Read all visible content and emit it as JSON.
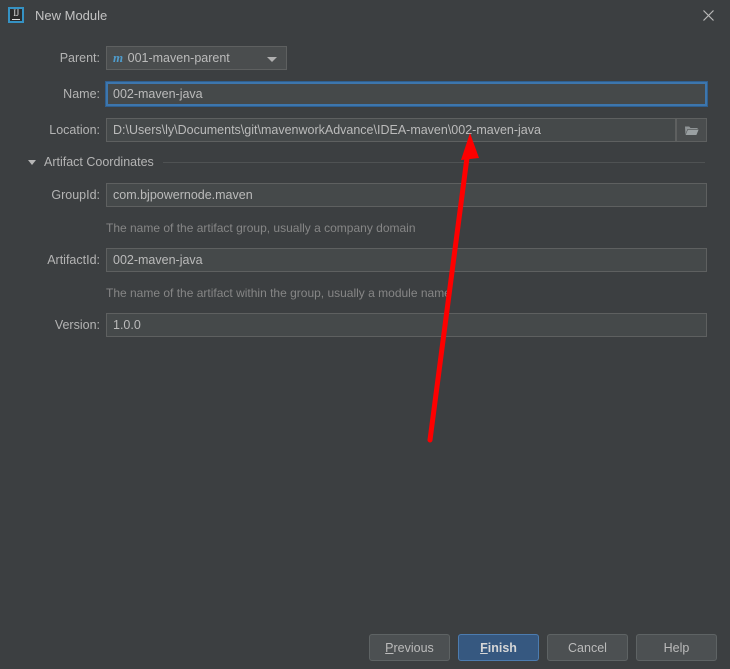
{
  "window": {
    "title": "New Module",
    "app_icon": "intellij-idea-icon",
    "close_label": "✕"
  },
  "form": {
    "parent": {
      "label": "Parent:",
      "value": "001-maven-parent",
      "icon": "maven-module-icon",
      "icon_glyph": "m"
    },
    "name": {
      "label": "Name:",
      "value": "002-maven-java",
      "focused": true
    },
    "location": {
      "label": "Location:",
      "value": "D:\\Users\\ly\\Documents\\git\\mavenworkAdvance\\IDEA-maven\\002-maven-java",
      "browse_icon": "folder-icon"
    },
    "section": {
      "label": "Artifact Coordinates",
      "expanded": true,
      "toggle_icon": "chevron-down-icon"
    },
    "group_id": {
      "label": "GroupId:",
      "value": "com.bjpowernode.maven",
      "hint": "The name of the artifact group, usually a company domain"
    },
    "artifact_id": {
      "label": "ArtifactId:",
      "value": "002-maven-java",
      "hint": "The name of the artifact within the group, usually a module name"
    },
    "version": {
      "label": "Version:",
      "value": "1.0.0"
    }
  },
  "buttons": {
    "previous": {
      "label": "Previous",
      "mnemonic": "P"
    },
    "finish": {
      "label": "Finish",
      "mnemonic": "F",
      "primary": true
    },
    "cancel": {
      "label": "Cancel"
    },
    "help": {
      "label": "Help"
    }
  },
  "annotation": {
    "type": "arrow",
    "color": "#fe0000",
    "points_to": "002-maven-java"
  },
  "colors": {
    "dialog_bg": "#3c3f41",
    "field_bg": "#45494a",
    "focus_border": "#3d76ad",
    "primary_button": "#365880",
    "accent_icon": "#4f9ccc",
    "annotation": "#fe0000"
  }
}
